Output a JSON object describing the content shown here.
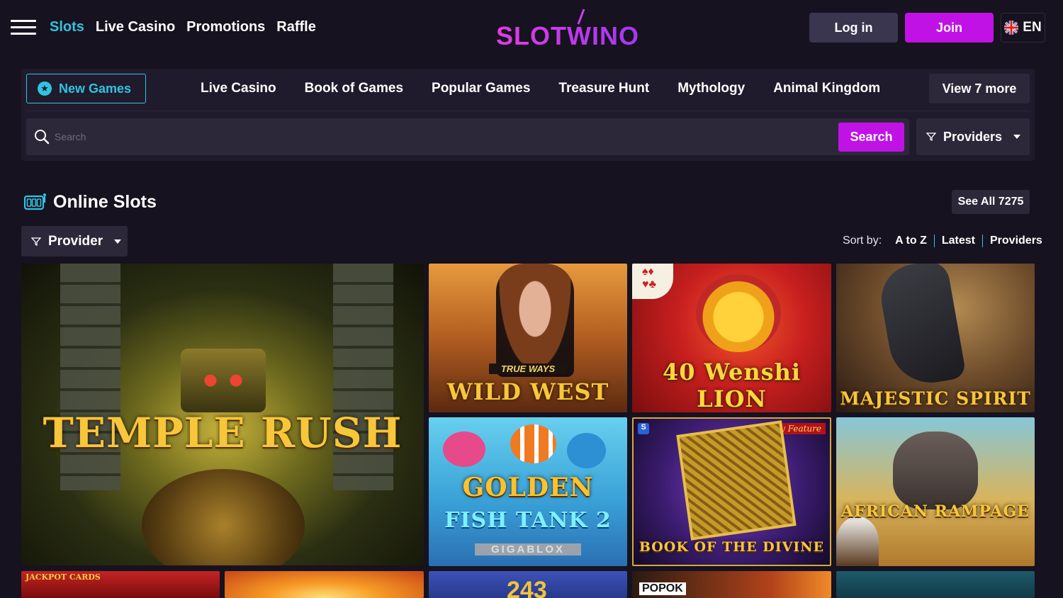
{
  "header": {
    "nav": [
      "Slots",
      "Live Casino",
      "Promotions",
      "Raffle"
    ],
    "logo_text": "SLOTWINO",
    "login_label": "Log in",
    "join_label": "Join",
    "language": "EN"
  },
  "categories": {
    "new_games_label": "New Games",
    "items": [
      "Live Casino",
      "Book of Games",
      "Popular Games",
      "Treasure Hunt",
      "Mythology",
      "Animal Kingdom"
    ],
    "view_more_label": "View 7 more",
    "search_placeholder": "Search",
    "search_button": "Search",
    "providers_label": "Providers"
  },
  "section": {
    "title": "Online Slots",
    "see_all_label": "See All 7275",
    "provider_filter_label": "Provider",
    "sort_label": "Sort by:",
    "sort_options": [
      "A to Z",
      "Latest",
      "Providers"
    ]
  },
  "games": [
    {
      "title": "TEMPLE RUSH"
    },
    {
      "title": "TRUE WAYS",
      "subtitle": "WILD WEST"
    },
    {
      "title": "40 Wenshi LION"
    },
    {
      "title": "MAJESTIC SPIRIT"
    },
    {
      "title": "GOLDEN",
      "subtitle": "FISH TANK 2",
      "tag": "GIGABLOX"
    },
    {
      "title": "BOOK OF THE DIVINE",
      "tag": "Buy Feature"
    },
    {
      "title": "AFRICAN RAMPAGE"
    },
    {
      "title": "JACKPOT CARDS"
    },
    {
      "title": ""
    },
    {
      "title": "243"
    },
    {
      "title": "POPOK"
    }
  ],
  "colors": {
    "background": "#16121f",
    "accent_cyan": "#2fc4e0",
    "accent_magenta": "#c112e6",
    "panel": "#1f1b2c",
    "button": "#2c2839"
  }
}
